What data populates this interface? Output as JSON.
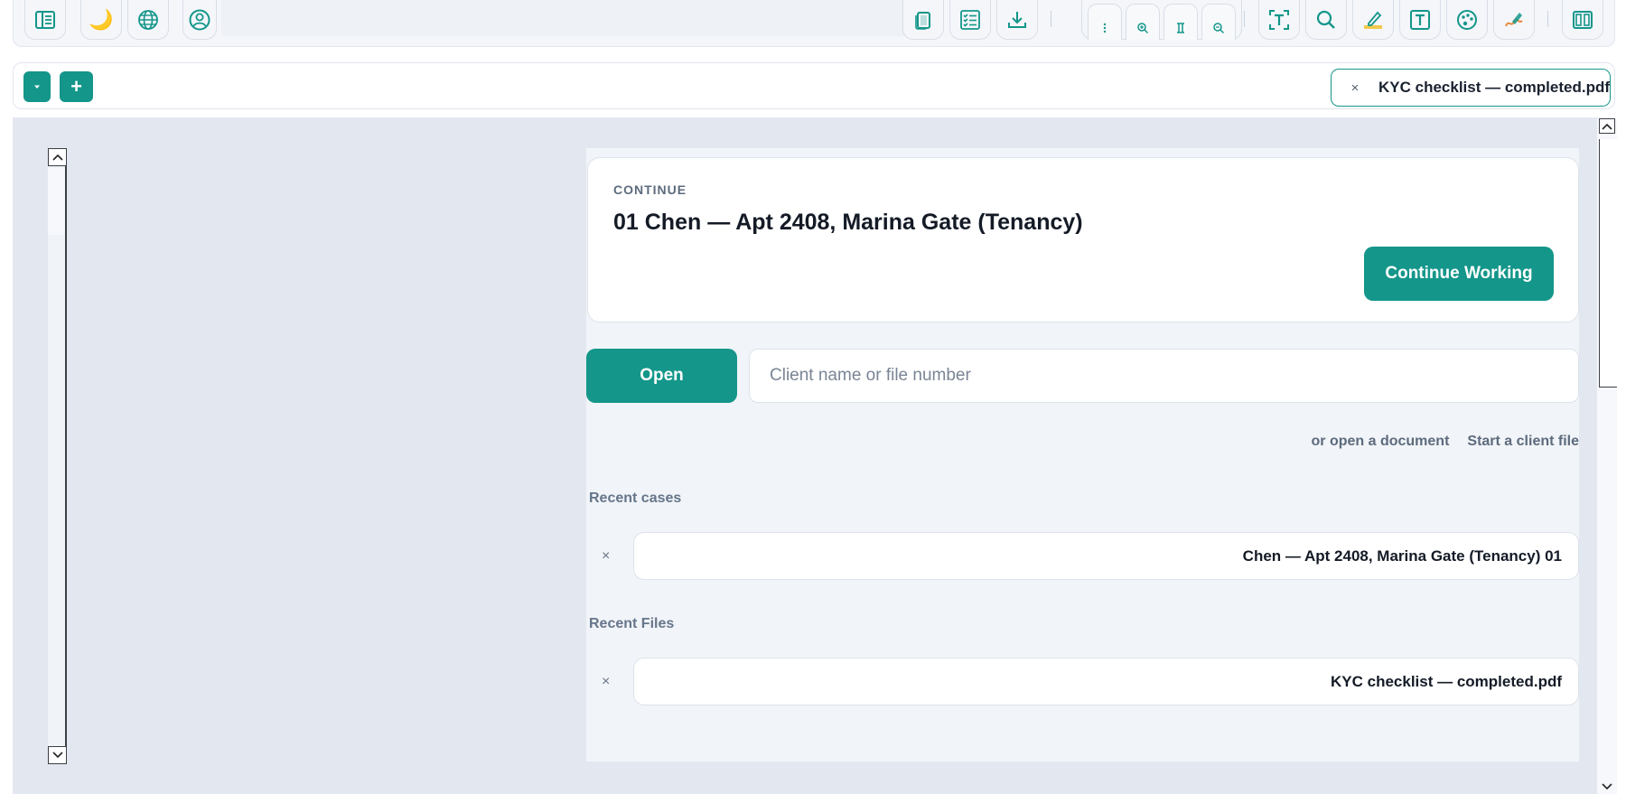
{
  "colors": {
    "accent": "#14968a",
    "workspace_bg": "#e3e8f0",
    "panel_bg": "#f1f4f8"
  },
  "toolbar": {
    "left_icons": [
      "sidebar-icon",
      "moon-icon",
      "globe-icon",
      "user-circle-icon"
    ],
    "right_icons": [
      "document-icon",
      "checklist-icon",
      "download-icon",
      "more-vertical-icon",
      "zoom-in-icon",
      "page-fit-icon",
      "zoom-out-icon",
      "text-select-icon",
      "search-icon",
      "highlight-icon",
      "text-box-icon",
      "palette-icon",
      "signature-icon",
      "columns-icon"
    ],
    "moon_glyph": "🌙"
  },
  "tabbar": {
    "dropdown_icon": "caret-down-icon",
    "add_icon": "plus-icon",
    "add_glyph": "+",
    "active_tab": {
      "label": "KYC checklist — completed.pdf",
      "close": "×"
    }
  },
  "main": {
    "continue": {
      "kicker": "CONTINUE",
      "title": "01 Chen — Apt 2408, Marina Gate (Tenancy)",
      "button": "Continue Working"
    },
    "open_button": "Open",
    "search": {
      "placeholder": "Client name or file number",
      "value": ""
    },
    "links": {
      "open_document": "or open a document",
      "start_client_file": "Start a client file"
    },
    "recent_cases": {
      "heading": "Recent cases",
      "items": [
        {
          "label": "Chen — Apt 2408, Marina Gate (Tenancy) 01",
          "remove": "×"
        }
      ]
    },
    "recent_files": {
      "heading": "Recent Files",
      "items": [
        {
          "label": "KYC checklist — completed.pdf",
          "remove": "×"
        }
      ]
    }
  }
}
